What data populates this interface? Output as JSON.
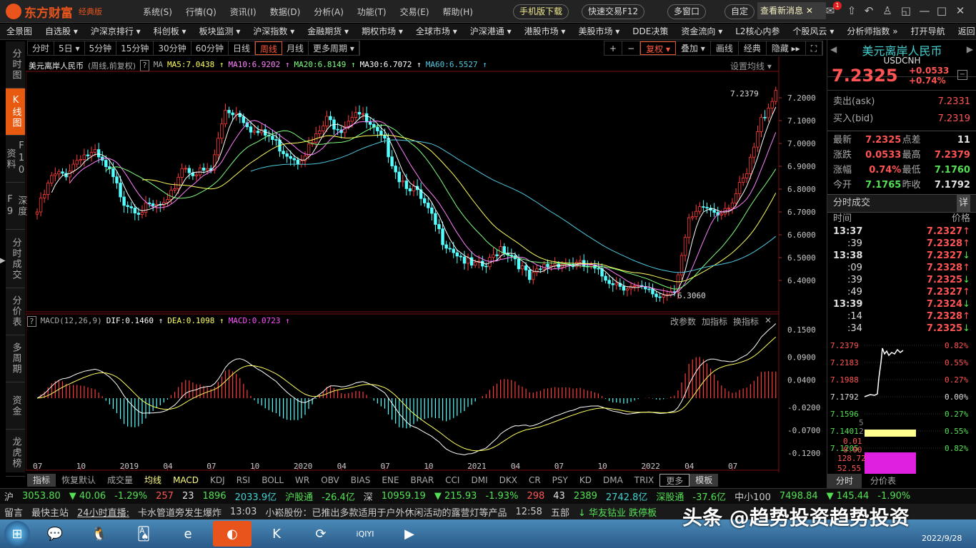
{
  "app": {
    "logo": "东方财富",
    "edition": "经典版",
    "menu": [
      "系统(S)",
      "行情(Q)",
      "资讯(I)",
      "数据(D)",
      "分析(A)",
      "功能(T)",
      "交易(E)",
      "帮助(H)"
    ],
    "mobile": "手机版下载",
    "quick_trade": "快速交易F12",
    "multi_window": "多窗口",
    "custom": "自定",
    "new_msg": "查看新消息",
    "msg_count": "1"
  },
  "nav": [
    "全景图",
    "自选股 ▾",
    "沪深京排行 ▾",
    "科创板 ▾",
    "板块监测 ▾",
    "沪深指数 ▾",
    "金融期货 ▾",
    "期权市场 ▾",
    "全球市场 ▾",
    "沪深港通 ▾",
    "港股市场 ▾",
    "美股市场 ▾",
    "DDE决策",
    "资金流向 ▾",
    "L2核心内参",
    "个股风云 ▾",
    "分析师指数 »",
    "打开导航",
    "返回"
  ],
  "sidebar": [
    "分时图",
    "K线图",
    "F10资料",
    "深度F9",
    "分时成交",
    "分价表",
    "多周期",
    "资金",
    "龙虎榜"
  ],
  "periods": [
    "分时",
    "5日 ▾",
    "5分钟",
    "15分钟",
    "30分钟",
    "60分钟",
    "日线",
    "周线",
    "月线",
    "更多周期 ▾"
  ],
  "active_period": "周线",
  "tools": [
    "+",
    "−",
    "复权 ▾",
    "叠加 ▾",
    "画线",
    "经典",
    "隐藏 ▸▸",
    "⛶"
  ],
  "info": {
    "name": "美元离岸人民币",
    "mode": "(周线,前复权)",
    "help": "?",
    "ma": "MA",
    "ma5": "MA5:7.0438 ↑",
    "ma10": "MA10:6.9202 ↑",
    "ma20": "MA20:6.8149 ↑",
    "ma30": "MA30:6.7072 ↑",
    "ma60": "MA60:6.5527 ↑",
    "set_ma": "设置均线 ▾"
  },
  "price_axis": [
    "7.2000",
    "7.1000",
    "7.0000",
    "6.9000",
    "6.8000",
    "6.7000",
    "6.6000",
    "6.5000",
    "6.4000"
  ],
  "high_label": "7.2379",
  "low_label": "6.3060",
  "macd": {
    "help": "?",
    "name": "MACD(12,26,9)",
    "dif": "DIF:0.1460 ↑",
    "dea": "DEA:0.1098 ↑",
    "macd": "MACD:0.0723 ↑",
    "tools": [
      "改参数",
      "加指标",
      "换指标",
      "✕"
    ],
    "axis": [
      "0.1500",
      "0.0900",
      "0.0400",
      "-0.0200",
      "-0.0700",
      "-0.1200"
    ]
  },
  "time_axis": [
    "07",
    "10",
    "2019",
    "04",
    "07",
    "10",
    "2020",
    "04",
    "07",
    "10",
    "2021",
    "04",
    "07",
    "10",
    "2022",
    "04",
    "07"
  ],
  "colors": {
    "up": "#ff3c3c",
    "down": "#54ffff",
    "ma5": "#ffffff",
    "ma10": "#ff80ff",
    "ma20": "#80ff80",
    "ma30": "#ffff60",
    "ma60": "#50c8e0"
  },
  "monthly_closes": [
    6.7,
    6.85,
    6.87,
    6.95,
    6.95,
    6.87,
    6.75,
    6.71,
    6.72,
    6.73,
    6.9,
    6.87,
    6.88,
    7.15,
    7.13,
    7.05,
    7.03,
    6.97,
    6.93,
    7.0,
    7.1,
    7.07,
    7.15,
    7.07,
    7.0,
    6.85,
    6.8,
    6.7,
    6.58,
    6.52,
    6.46,
    6.46,
    6.55,
    6.5,
    6.4,
    6.46,
    6.48,
    6.47,
    6.46,
    6.42,
    6.39,
    6.37,
    6.35,
    6.33,
    6.37,
    6.65,
    6.72,
    6.7,
    6.75,
    6.86,
    7.1,
    7.2325
  ],
  "indicators": [
    "指标",
    "恢复默认",
    "成交量",
    "均线",
    "MACD",
    "KDJ",
    "RSI",
    "BOLL",
    "WR",
    "OBV",
    "BIAS",
    "ENE",
    "BRAR",
    "CCI",
    "DMI",
    "DKX",
    "CR",
    "PSY",
    "KD",
    "DMA",
    "TRIX",
    "更多",
    "模板"
  ],
  "right": {
    "name": "美元离岸人民币",
    "code": "USDCNH",
    "price": "7.2325",
    "change": "+0.0533",
    "pct": "+0.74%",
    "ask_label": "卖出(ask)",
    "ask": "7.2331",
    "bid_label": "买入(bid)",
    "bid": "7.2319",
    "quotes": [
      [
        "最新",
        "7.2325",
        "点差",
        "11"
      ],
      [
        "涨跌",
        "0.0533",
        "最高",
        "7.2379"
      ],
      [
        "涨幅",
        "0.74%",
        "最低",
        "7.1760"
      ],
      [
        "今开",
        "7.1765",
        "昨收",
        "7.1792"
      ]
    ],
    "ticks_title": "分时成交",
    "detail": "详",
    "time_h": "时间",
    "price_h": "价格",
    "ticks": [
      [
        "13:37",
        "7.2327",
        "↑"
      ],
      [
        ":39",
        "7.2328",
        "↑"
      ],
      [
        "13:38",
        "7.2327",
        "↓"
      ],
      [
        ":09",
        "7.2328",
        "↑"
      ],
      [
        ":39",
        "7.2325",
        "↓"
      ],
      [
        ":49",
        "7.2327",
        "↑"
      ],
      [
        "13:39",
        "7.2324",
        "↓"
      ],
      [
        ":14",
        "7.2328",
        "↑"
      ],
      [
        ":34",
        "7.2325",
        "↓"
      ]
    ],
    "mini_left": [
      "7.2379",
      "7.2183",
      "7.1988",
      "7.1792",
      "7.1596",
      "7.1401",
      "7.1205"
    ],
    "mini_right": [
      "0.82%",
      "0.55%",
      "0.27%",
      "0.00%",
      "0.27%",
      "0.55%",
      "0.82%"
    ],
    "sub_labels": [
      "5",
      "2",
      "0.01",
      "0.00",
      "128.72",
      "52.55"
    ],
    "tabs": [
      "分时",
      "分价表"
    ]
  },
  "status": {
    "sh": "沪",
    "sh_idx": "3053.80",
    "sh_chg": "▼ 40.06",
    "sh_pct": "-1.29%",
    "sh_up": "257",
    "sh_flat": "23",
    "sh_dn": "1896",
    "sh_amt": "2033.9亿",
    "hgt": "沪股通",
    "hgt_v": "-26.4亿",
    "sz": "深",
    "sz_idx": "10959.19",
    "sz_chg": "▼ 215.93",
    "sz_pct": "-1.93%",
    "sz_up": "298",
    "sz_flat": "43",
    "sz_dn": "2389",
    "sz_amt": "2742.8亿",
    "sgt": "深股通",
    "sgt_v": "-37.6亿",
    "zx": "中小100",
    "zx_idx": "7498.84",
    "zx_chg": "▼ 145.44",
    "zx_pct": "-1.90%"
  },
  "news": {
    "msg": "留言",
    "fast": "最快主站",
    "live": "24小时直播:",
    "n1": "卡水管道旁发生爆炸",
    "t2": "13:03",
    "n2": "小崧股份：已推出多款适用于户外休闲活动的露营灯等产品",
    "t3": "12:58",
    "n3": "五部",
    "n4": "↓ 华友钴业 跌停板"
  },
  "watermark": "头条 @趋势投资趋势投资",
  "date": "2022/9/28"
}
